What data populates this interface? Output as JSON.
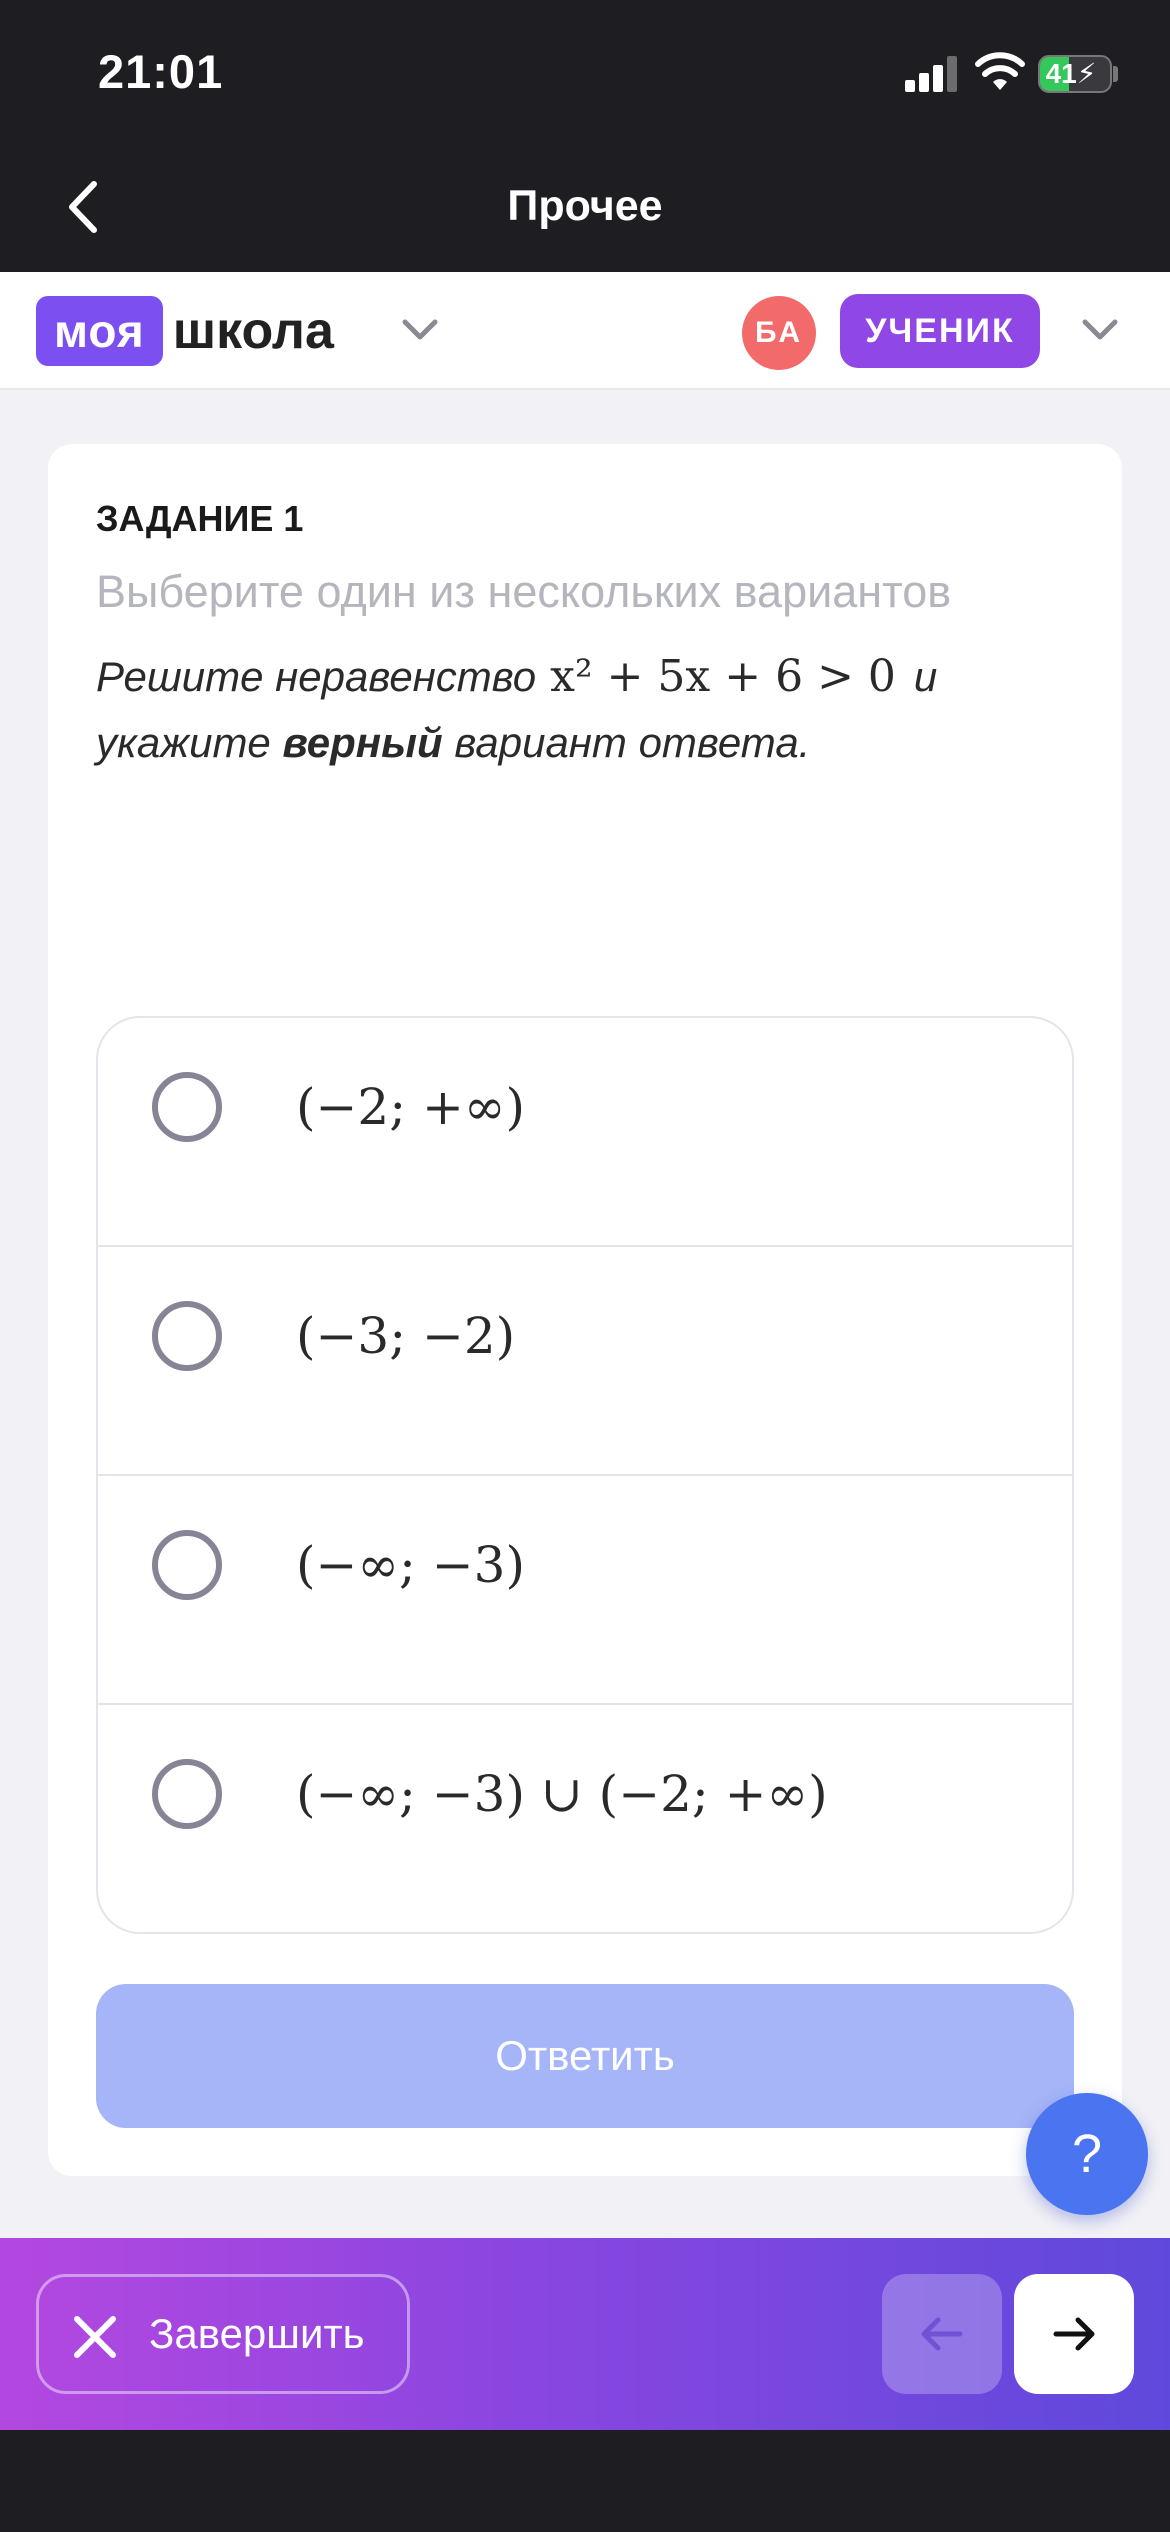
{
  "status_bar": {
    "time": "21:01",
    "battery_percent": "41",
    "battery_level": 0.41,
    "charging": true
  },
  "nav": {
    "title": "Прочее",
    "back_icon": "chevron-left-icon"
  },
  "header": {
    "logo_badge": "моя",
    "logo_word": "школа",
    "avatar_initials": "БА",
    "role": "УЧЕНИК"
  },
  "task": {
    "number_label": "ЗАДАНИЕ 1",
    "instruction": "Выберите один из нескольких вариантов",
    "question_prefix": "Решите неравенство",
    "question_math": "x² + 5x + 6 > 0",
    "question_mid": "и",
    "question_line2_start": "укажите",
    "question_bold": "верный",
    "question_end": "вариант ответа.",
    "options": [
      {
        "label": "(−2; +∞)"
      },
      {
        "label": "(−3; −2)"
      },
      {
        "label": "(−∞; −3)"
      },
      {
        "label": "(−∞; −3) ∪ (−2; +∞)"
      }
    ],
    "answer_button": "Ответить",
    "help_button": "?"
  },
  "bottom_bar": {
    "finish_label": "Завершить",
    "prev_icon": "arrow-left-icon",
    "next_icon": "arrow-right-icon"
  },
  "colors": {
    "brand_purple": "#7b4ff0",
    "role_badge": "#8f48e6",
    "avatar": "#f36a6a",
    "answer_button_disabled": "#a5b5f7",
    "help_button": "#4b74f0",
    "bottom_gradient_start": "#b348e0",
    "bottom_gradient_end": "#5f49dc"
  }
}
